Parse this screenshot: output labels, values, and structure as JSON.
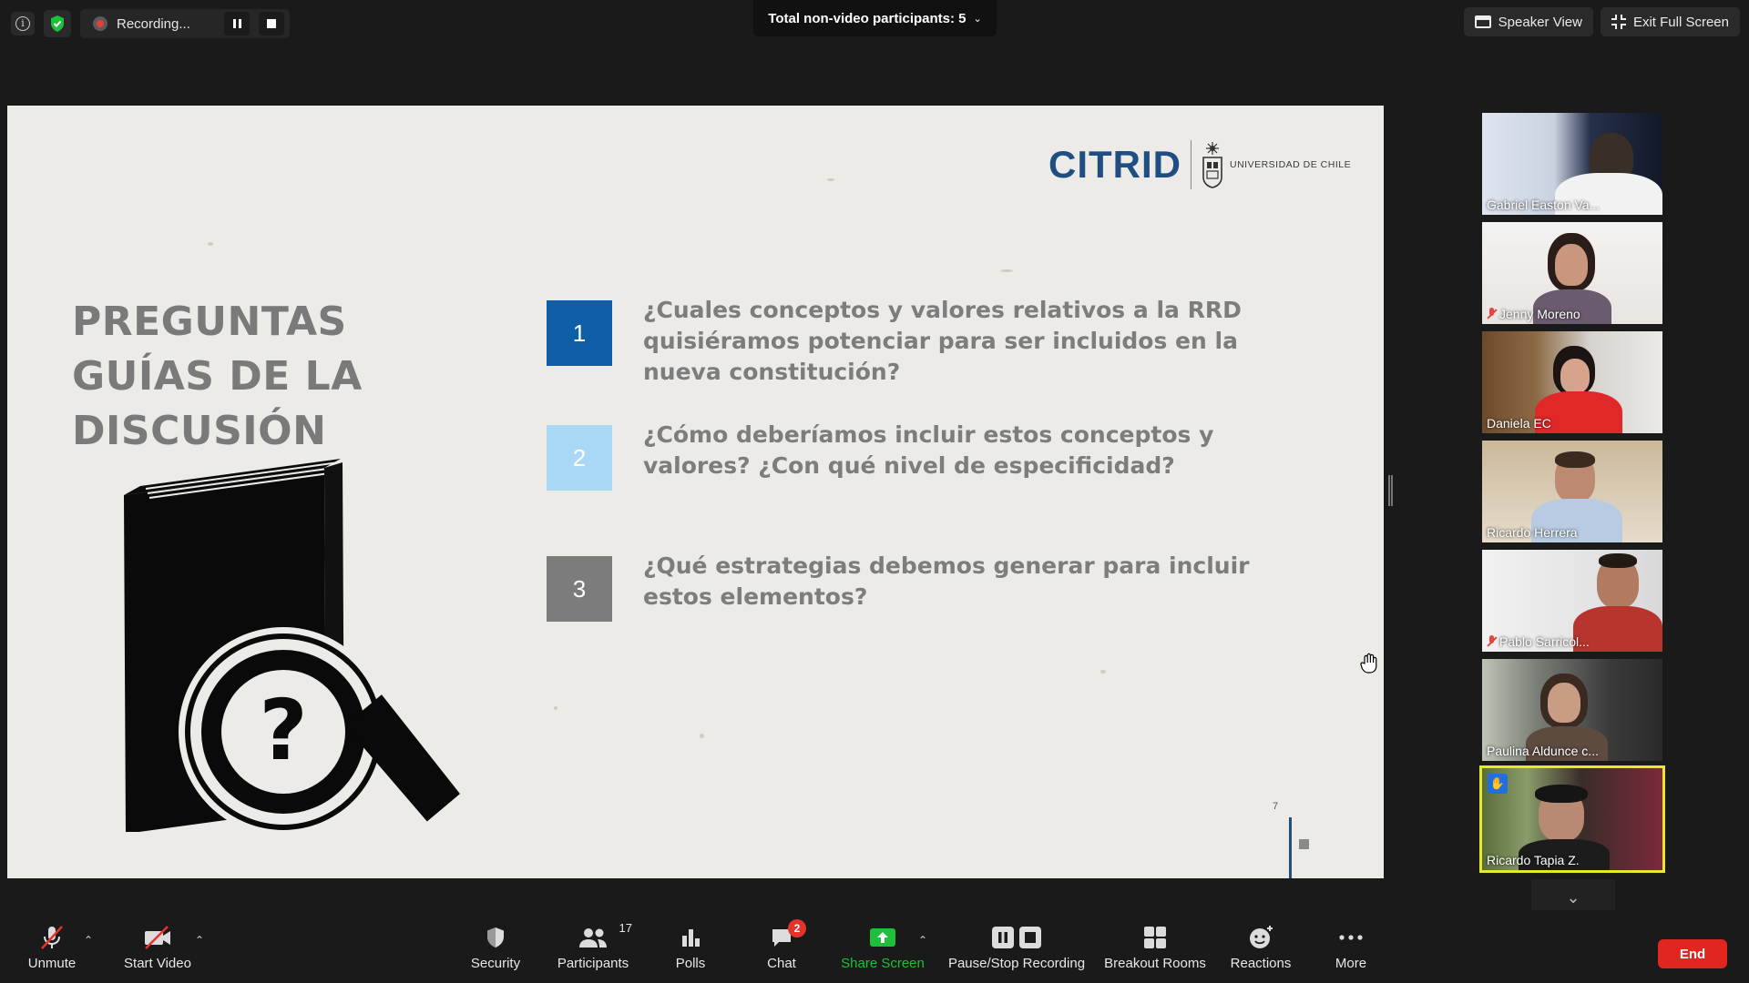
{
  "topbar": {
    "recording_label": "Recording...",
    "participants_label": "Total non-video participants: 5",
    "speaker_view_label": "Speaker View",
    "exit_fullscreen_label": "Exit Full Screen"
  },
  "slide": {
    "logo_text": "CITRID",
    "university_text": "UNIVERSIDAD DE CHILE",
    "title": "PREGUNTAS GUÍAS DE LA DISCUSIÓN",
    "questions": [
      {
        "number": "1",
        "text": "¿Cuales conceptos y valores relativos a la RRD quisiéramos potenciar para ser incluidos en la nueva constitución?",
        "color": "#0e5ea8"
      },
      {
        "number": "2",
        "text": "¿Cómo deberíamos incluir estos conceptos y valores? ¿Con qué nivel de especificidad?",
        "color": "#a9d8f5"
      },
      {
        "number": "3",
        "text": " ¿Qué estrategias debemos generar para incluir estos elementos?",
        "color": "#7c7c7c"
      }
    ],
    "page_number": "7"
  },
  "gallery": [
    {
      "name": "Gabriel Easton Va...",
      "muted": false
    },
    {
      "name": "Jenny Moreno",
      "muted": true
    },
    {
      "name": "Daniela EC",
      "muted": false
    },
    {
      "name": "Ricardo Herrera",
      "muted": false
    },
    {
      "name": "Pablo Sarricol...",
      "muted": true
    },
    {
      "name": "Paulina Aldunce c...",
      "muted": false
    },
    {
      "name": "Ricardo Tapia Z.",
      "muted": false,
      "active": true,
      "hand_raised": true
    }
  ],
  "toolbar": {
    "unmute": "Unmute",
    "start_video": "Start Video",
    "security": "Security",
    "participants": "Participants",
    "participants_count": "17",
    "polls": "Polls",
    "chat": "Chat",
    "chat_badge": "2",
    "share_screen": "Share Screen",
    "pause_stop_recording": "Pause/Stop Recording",
    "breakout_rooms": "Breakout Rooms",
    "reactions": "Reactions",
    "more": "More",
    "end": "End"
  },
  "colors": {
    "accent_green": "#1fbf3a",
    "end_red": "#e0261f",
    "slide_blue": "#1f4e82"
  }
}
